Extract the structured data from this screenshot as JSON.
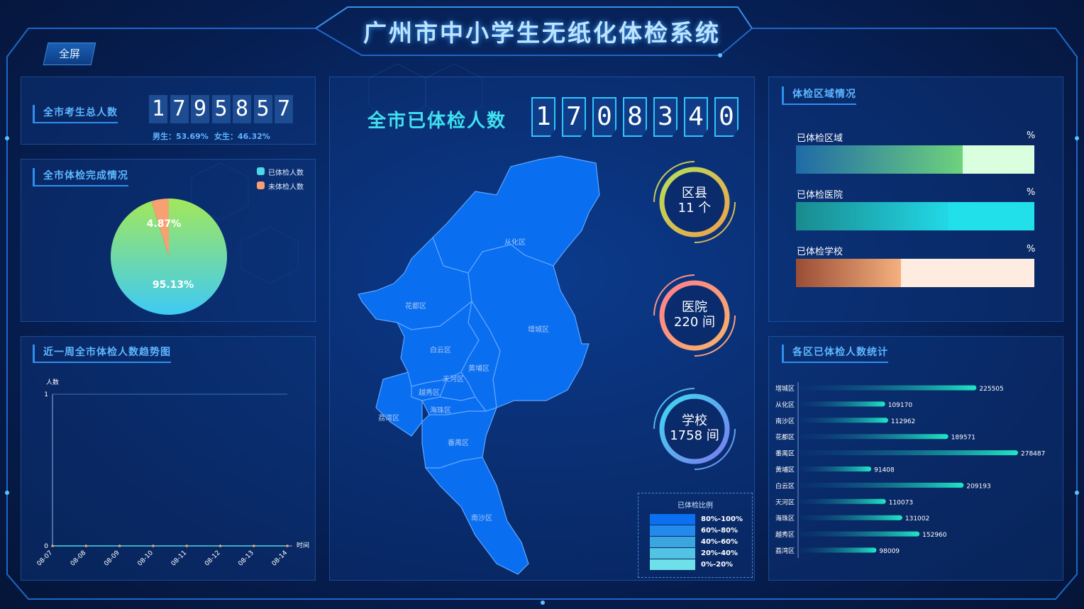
{
  "app": {
    "title": "广州市中小学生无纸化体检系统",
    "fullscreen_label": "全屏"
  },
  "total": {
    "title": "全市考生总人数",
    "digits": [
      "1",
      "7",
      "9",
      "5",
      "8",
      "5",
      "7"
    ],
    "male": "男生：53.69%",
    "female": "女生：46.32%"
  },
  "completion": {
    "title": "全市体检完成情况",
    "legend": [
      {
        "label": "已体检人数",
        "color": "#4dd7e8"
      },
      {
        "label": "未体检人数",
        "color": "#f7a071"
      }
    ],
    "done_pct_label": "95.13%",
    "undone_pct_label": "4.87%",
    "chart_data": {
      "type": "pie",
      "categories": [
        "已体检人数",
        "未体检人数"
      ],
      "values": [
        95.13,
        4.87
      ]
    }
  },
  "trend": {
    "title": "近一周全市体检人数趋势图",
    "ylabel": "人数",
    "xlabel": "时间",
    "chart_data": {
      "type": "line",
      "categories": [
        "08-07",
        "08-08",
        "08-09",
        "08-10",
        "08-11",
        "08-12",
        "08-13",
        "08-14"
      ],
      "values": [
        0,
        0,
        0,
        0,
        0,
        0,
        0,
        0
      ],
      "ylim": [
        0,
        1
      ],
      "yticks": [
        "0",
        "1"
      ]
    }
  },
  "center": {
    "title": "全市已体检人数",
    "digits": [
      "1",
      "7",
      "0",
      "8",
      "3",
      "4",
      "0"
    ],
    "rings": [
      {
        "line1": "区县",
        "line2": "11 个"
      },
      {
        "line1": "医院",
        "line2": "220 间"
      },
      {
        "line1": "学校",
        "line2": "1758 间"
      }
    ],
    "map_regions": [
      "从化区",
      "花都区",
      "增城区",
      "白云区",
      "黄埔区",
      "天河区",
      "越秀区",
      "荔湾区",
      "海珠区",
      "番禺区",
      "南沙区"
    ],
    "legend_title": "已体检比例",
    "legend": [
      {
        "label": "80%-100%",
        "color": "#0a6ff0"
      },
      {
        "label": "60%-80%",
        "color": "#2389ea"
      },
      {
        "label": "40%-60%",
        "color": "#3ba5e0"
      },
      {
        "label": "20%-40%",
        "color": "#52c3e2"
      },
      {
        "label": "0%-20%",
        "color": "#6ee0ea"
      }
    ]
  },
  "area": {
    "title": "体检区域情况",
    "bars": [
      {
        "label": "已体检区域",
        "unit": "%",
        "fill": 0.7
      },
      {
        "label": "已体检医院",
        "unit": "%",
        "fill": 0.64
      },
      {
        "label": "已体检学校",
        "unit": "%",
        "fill": 0.44
      }
    ]
  },
  "district": {
    "title": "各区已体检人数统计",
    "chart_data": {
      "type": "bar",
      "categories": [
        "增城区",
        "从化区",
        "南沙区",
        "花都区",
        "番禺区",
        "黄埔区",
        "白云区",
        "天河区",
        "海珠区",
        "越秀区",
        "荔湾区"
      ],
      "values": [
        225505,
        109170,
        112962,
        189571,
        278487,
        91408,
        209193,
        110073,
        131002,
        152960,
        98009
      ]
    }
  }
}
